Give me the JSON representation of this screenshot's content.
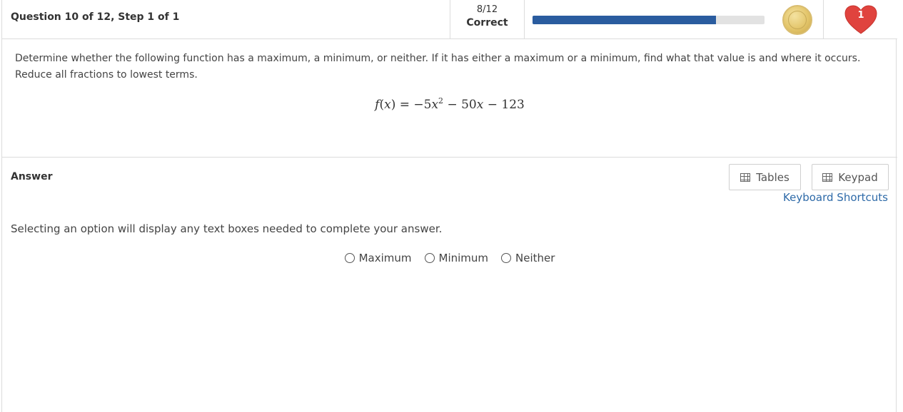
{
  "header": {
    "question_title": "Question 10 of 12, Step 1 of 1",
    "score_fraction": "8/12",
    "score_label": "Correct",
    "progress": 0.79,
    "hearts_count": "1"
  },
  "question": {
    "prompt": "Determine whether the following function has a maximum, a minimum, or neither. If it has either a maximum or a minimum, find what that value is and where it occurs. Reduce all fractions to lowest terms.",
    "formula": {
      "f": "f",
      "x": "x",
      "eq": " = −5",
      "x2": "x",
      "exp": "2",
      "mid": " − 50",
      "x3": "x",
      "tail": " − 123"
    }
  },
  "answer": {
    "label": "Answer",
    "tables_label": "Tables",
    "keypad_label": "Keypad",
    "shortcuts_label": "Keyboard Shortcuts",
    "instructions": "Selecting an option will display any text boxes needed to complete your answer.",
    "options": [
      "Maximum",
      "Minimum",
      "Neither"
    ]
  },
  "colors": {
    "accent": "#2a5c9f",
    "link": "#2e6aa8",
    "heart": "#e0433e"
  }
}
